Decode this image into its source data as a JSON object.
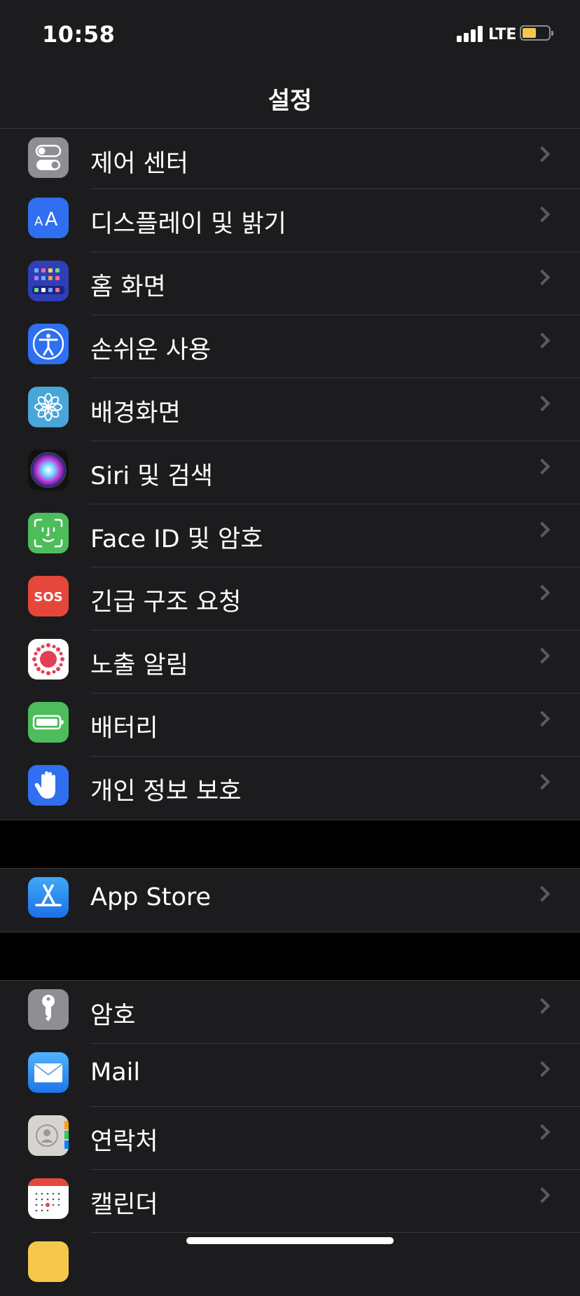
{
  "status_bar": {
    "time": "10:58",
    "network": "LTE"
  },
  "nav": {
    "title": "설정"
  },
  "groups": [
    {
      "items": [
        {
          "label": "제어 센터",
          "icon": "control-center-icon",
          "color": "#8e8e93"
        },
        {
          "label": "디스플레이 및 밝기",
          "icon": "display-brightness-icon",
          "color": "#2f6ff0"
        },
        {
          "label": "홈 화면",
          "icon": "home-screen-icon",
          "color": "#2f3fb8"
        },
        {
          "label": "손쉬운 사용",
          "icon": "accessibility-icon",
          "color": "#2f6ff0"
        },
        {
          "label": "배경화면",
          "icon": "wallpaper-icon",
          "color": "#4aa5d8"
        },
        {
          "label": "Siri 및 검색",
          "icon": "siri-icon",
          "color": "#111"
        },
        {
          "label": "Face ID 및 암호",
          "icon": "face-id-icon",
          "color": "#4cbd5a"
        },
        {
          "label": "긴급 구조 요청",
          "icon": "sos-icon",
          "color": "#e5483b",
          "icon_text": "SOS"
        },
        {
          "label": "노출 알림",
          "icon": "exposure-notifications-icon",
          "color": "#ffffff"
        },
        {
          "label": "배터리",
          "icon": "battery-icon",
          "color": "#4cbd5a"
        },
        {
          "label": "개인 정보 보호",
          "icon": "privacy-hand-icon",
          "color": "#2f6ff0"
        }
      ]
    },
    {
      "items": [
        {
          "label": "App Store",
          "icon": "app-store-icon",
          "color": "#2f8ef0"
        }
      ]
    },
    {
      "items": [
        {
          "label": "암호",
          "icon": "passwords-key-icon",
          "color": "#8e8e93"
        },
        {
          "label": "Mail",
          "icon": "mail-icon",
          "color": "#3a8ff0"
        },
        {
          "label": "연락처",
          "icon": "contacts-icon",
          "color": "#d6d4cf"
        },
        {
          "label": "캘린더",
          "icon": "calendar-icon",
          "color": "#ffffff"
        }
      ]
    }
  ]
}
